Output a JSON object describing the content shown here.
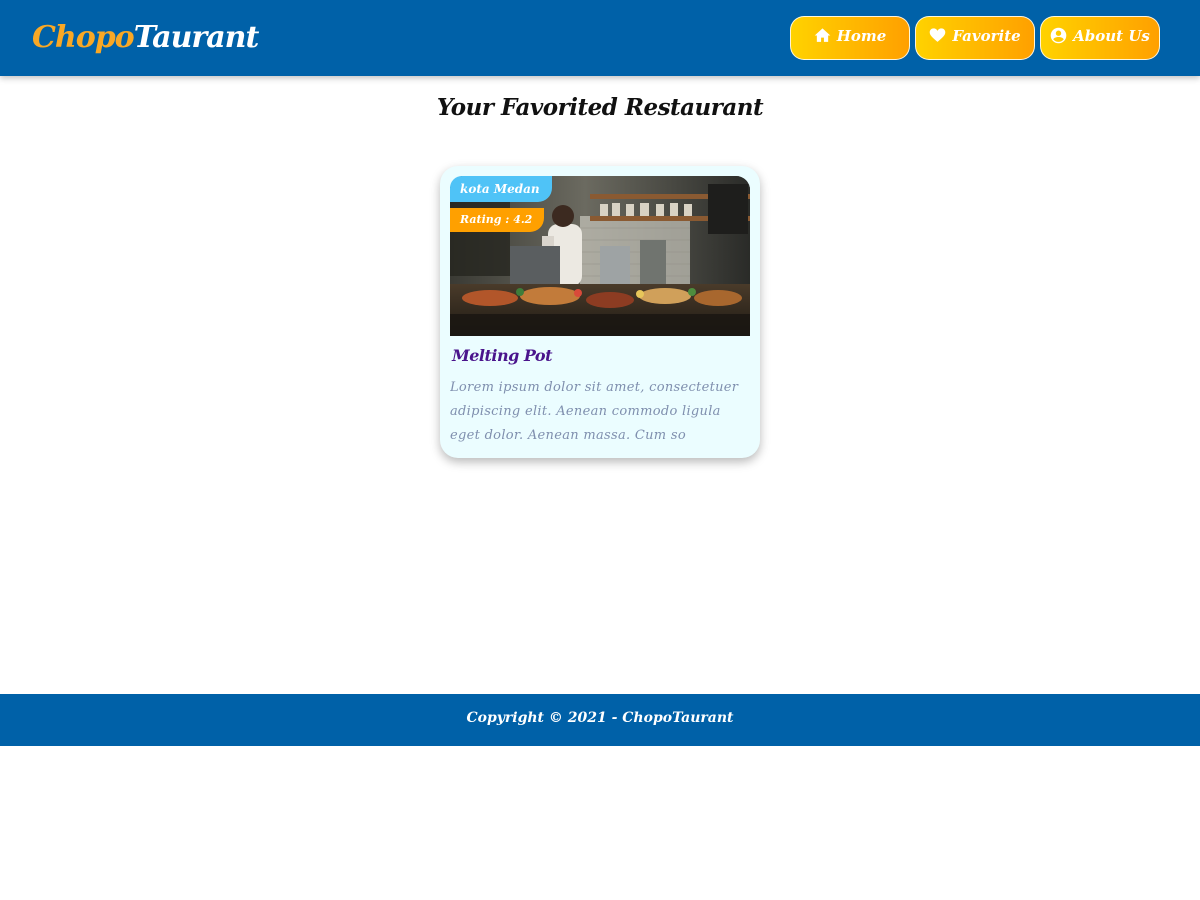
{
  "header": {
    "logo_part1": "Chopo",
    "logo_part2": "Taurant",
    "nav": [
      {
        "label": "Home",
        "icon": "home-icon"
      },
      {
        "label": "Favorite",
        "icon": "heart-icon"
      },
      {
        "label": "About Us",
        "icon": "user-circle-icon"
      }
    ]
  },
  "main": {
    "title": "Your Favorited Restaurant",
    "restaurants": [
      {
        "city": "kota Medan",
        "rating_text": "Rating : 4.2",
        "name": "Melting Pot",
        "description": "Lorem ipsum dolor sit amet, consectetuer adipiscing elit. Aenean commodo ligula eget dolor. Aenean massa. Cum so"
      }
    ]
  },
  "footer": {
    "copyright": "Copyright © 2021 - ChopoTaurant"
  },
  "colors": {
    "header_bg": "#0061a8",
    "accent_yellow": "#ffd200",
    "accent_orange": "#ffa000",
    "city_badge": "#4fc3f7",
    "card_bg": "#ebfdff",
    "title_purple": "#4a148c"
  }
}
